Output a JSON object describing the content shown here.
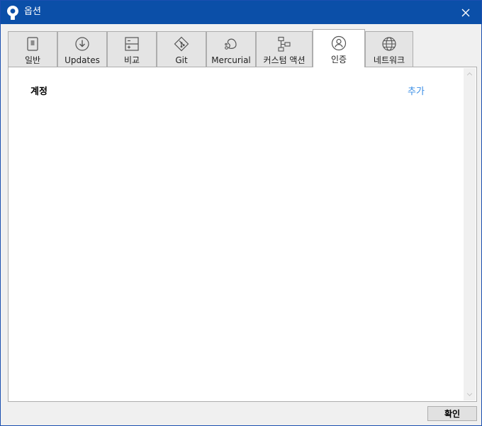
{
  "window": {
    "title": "옵션",
    "accent_color": "#0b4fa8"
  },
  "tabs": [
    {
      "label": "일반",
      "icon": "switch-icon"
    },
    {
      "label": "Updates",
      "icon": "download-circle-icon"
    },
    {
      "label": "비교",
      "icon": "diff-icon"
    },
    {
      "label": "Git",
      "icon": "git-icon"
    },
    {
      "label": "Mercurial",
      "icon": "mercurial-icon"
    },
    {
      "label": "커스텀 액션",
      "icon": "flowchart-icon"
    },
    {
      "label": "인증",
      "icon": "user-circle-icon",
      "active": true
    },
    {
      "label": "네트워크",
      "icon": "globe-icon"
    }
  ],
  "auth": {
    "section_title": "계정",
    "add_label": "추가",
    "link_color": "#3a8ee6"
  },
  "footer": {
    "ok_label": "확인"
  }
}
